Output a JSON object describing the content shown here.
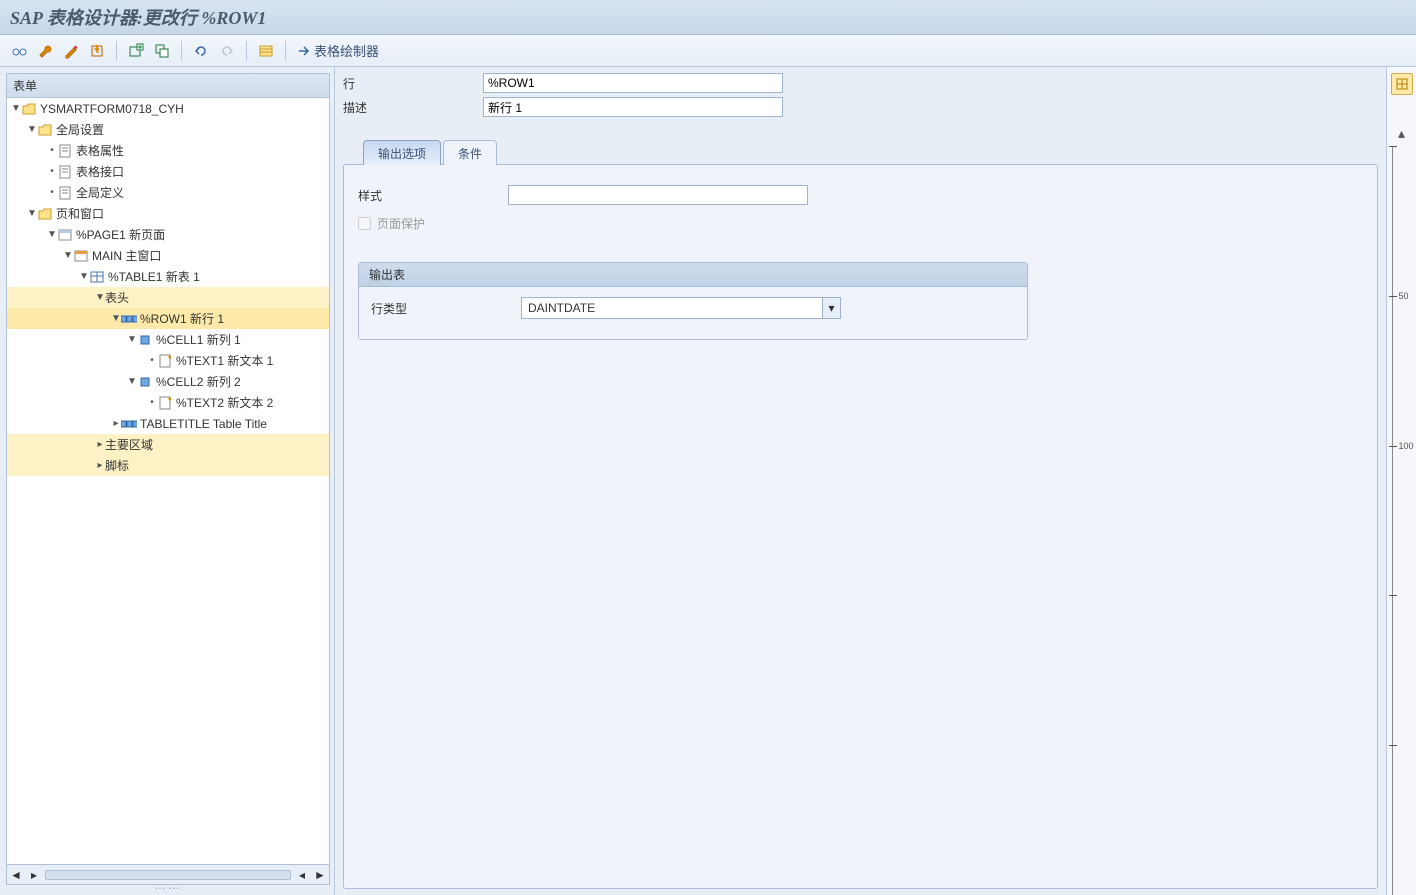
{
  "title": "SAP 表格设计器:更改行 %ROW1",
  "toolbar": {
    "painter_label": "表格绘制器"
  },
  "tree": {
    "header": "表单",
    "root": "YSMARTFORM0718_CYH",
    "global_settings": "全局设置",
    "form_attrs": "表格属性",
    "form_iface": "表格接口",
    "global_defs": "全局定义",
    "pages_windows": "页和窗口",
    "page1": "%PAGE1 新页面",
    "main_win": "MAIN 主窗口",
    "table1": "%TABLE1 新表 1",
    "header_area": "表头",
    "row1": "%ROW1 新行 1",
    "cell1": "%CELL1 新列 1",
    "text1": "%TEXT1 新文本 1",
    "cell2": "%CELL2 新列 2",
    "text2": "%TEXT2 新文本 2",
    "tabletitle": "TABLETITLE Table Title",
    "main_area": "主要区域",
    "footer": "脚标"
  },
  "detail": {
    "row_label": "行",
    "row_value": "%ROW1",
    "desc_label": "描述",
    "desc_value": "新行 1",
    "tabs": {
      "output": "输出选项",
      "cond": "条件"
    },
    "style_label": "样式",
    "style_value": "",
    "page_protect": "页面保护",
    "section_title": "输出表",
    "row_type_label": "行类型",
    "row_type_value": "DAINTDATE"
  },
  "ruler": {
    "m50": "50",
    "m100": "100"
  }
}
